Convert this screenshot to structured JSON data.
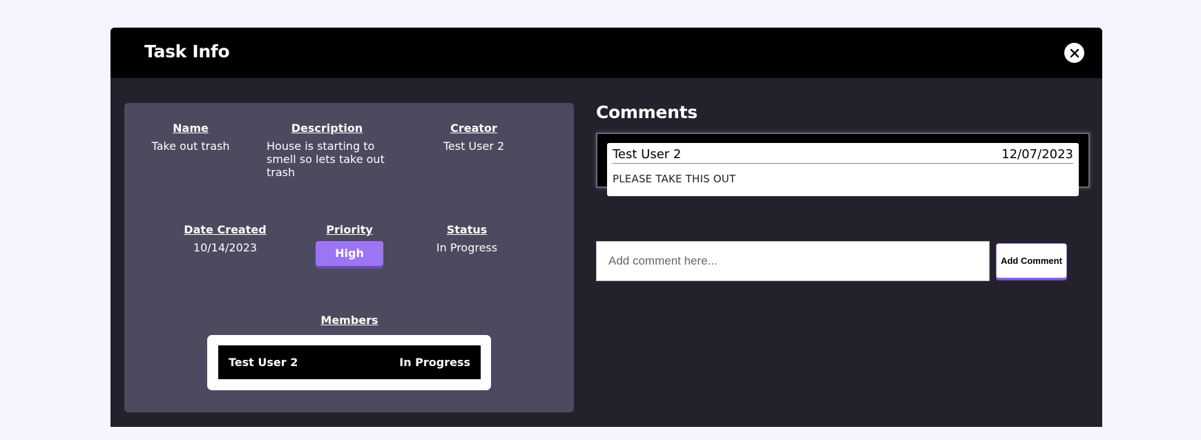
{
  "modal": {
    "title": "Task Info"
  },
  "task": {
    "name_label": "Name",
    "name_value": "Take out trash",
    "description_label": "Description",
    "description_value": "House is starting to smell so lets take out trash",
    "creator_label": "Creator",
    "creator_value": "Test User 2",
    "date_created_label": "Date Created",
    "date_created_value": "10/14/2023",
    "priority_label": "Priority",
    "priority_value": "High",
    "status_label": "Status",
    "status_value": "In Progress",
    "members_label": "Members",
    "members": [
      {
        "name": "Test User 2",
        "status": "In Progress"
      }
    ]
  },
  "comments": {
    "title": "Comments",
    "items": [
      {
        "author": "Test User 2",
        "date": "12/07/2023",
        "text": "PLEASE TAKE THIS OUT"
      }
    ],
    "input_placeholder": "Add comment here...",
    "add_button_label": "Add Comment"
  },
  "colors": {
    "accent": "#9d74f1",
    "panel": "#4b4a5e",
    "modal_bg": "#24212d",
    "page_bg": "#f4f5ff"
  }
}
